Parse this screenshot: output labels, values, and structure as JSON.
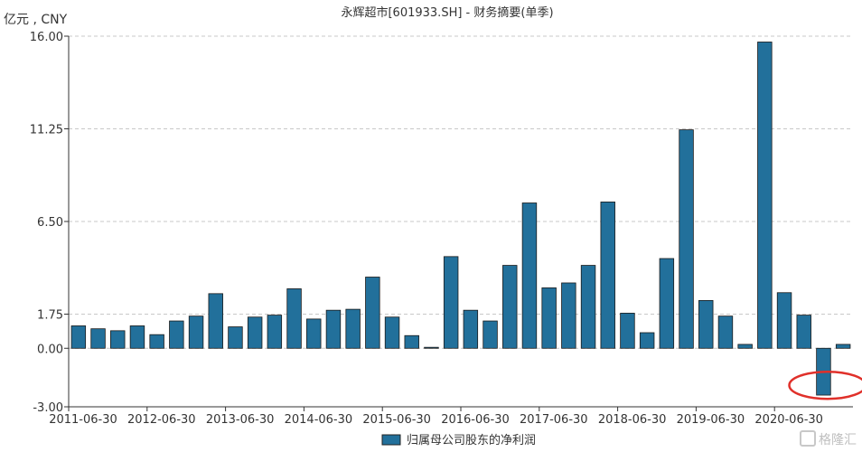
{
  "chart_data": {
    "type": "bar",
    "title": "永辉超市[601933.SH] - 财务摘要(单季)",
    "unit_label": "亿元 , CNY",
    "ylim": [
      -3.0,
      16.0
    ],
    "yticks": [
      "-3.00",
      "0.00",
      "1.75",
      "6.50",
      "11.25",
      "16.00"
    ],
    "ytick_values": [
      -3.0,
      0.0,
      1.75,
      6.5,
      11.25,
      16.0
    ],
    "grid": true,
    "legend_position": "bottom",
    "xtick_labels": [
      "2011-06-30",
      "2012-06-30",
      "2013-06-30",
      "2014-06-30",
      "2015-06-30",
      "2016-06-30",
      "2017-06-30",
      "2018-06-30",
      "2019-06-30",
      "2020-06-30"
    ],
    "bar_color": "#22709b",
    "highlight_color": "#e0302a",
    "series": [
      {
        "name": "归属母公司股东的净利润",
        "values": [
          1.15,
          1.0,
          0.9,
          1.15,
          0.7,
          1.4,
          1.65,
          2.8,
          1.1,
          1.6,
          1.7,
          3.05,
          1.5,
          1.95,
          2.0,
          3.65,
          1.6,
          0.65,
          0.05,
          4.7,
          1.95,
          1.4,
          4.25,
          7.45,
          3.1,
          3.35,
          4.25,
          7.5,
          1.8,
          0.8,
          4.6,
          11.2,
          2.45,
          1.65,
          0.2,
          15.7,
          2.85,
          1.7,
          -2.4,
          0.2
        ]
      }
    ]
  },
  "watermark": "格隆汇"
}
